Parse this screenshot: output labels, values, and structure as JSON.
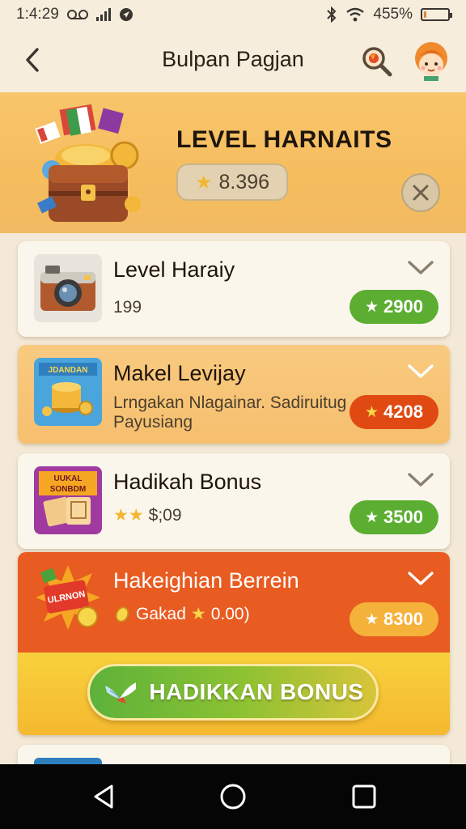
{
  "status_bar": {
    "time": "1:4:29",
    "carrier_icon": "voicemail-icon",
    "battery": "455%",
    "battery_level": 0.12
  },
  "header": {
    "title": "Bulpan Pagjan"
  },
  "hero": {
    "title": "LEVEL HARNAITS",
    "score": "8.396"
  },
  "items": [
    {
      "name": "Level Haraiy",
      "subtitle": "199",
      "price": "2900",
      "pill_color": "#5cae32"
    },
    {
      "name": "Makel Levijay",
      "subtitle_line1": "Lrngakan Nlagainar. Sadiruitug",
      "subtitle_line2": "Payusiang",
      "price": "4208",
      "pill_color": "#e04a12"
    },
    {
      "name": "Hadikah Bonus",
      "subtitle": "$;09",
      "price": "3500",
      "pill_color": "#5cae32"
    },
    {
      "name": "Hakeighian Berrein",
      "subtitle_prefix": "Gakad",
      "subtitle_value": "0.00)",
      "price": "8300",
      "pill_color": "#f5b23a"
    }
  ],
  "thumb_labels": {
    "item2": "JDANDAN",
    "item3_line1": "UUKAL",
    "item3_line2": "SONBDM",
    "item4": "ULRNON"
  },
  "cta": {
    "label": "HADIKKAN BONUS"
  },
  "colors": {
    "hero_bg": "#f6bd5e",
    "accent_orange": "#e85b21",
    "green": "#5cae32"
  }
}
